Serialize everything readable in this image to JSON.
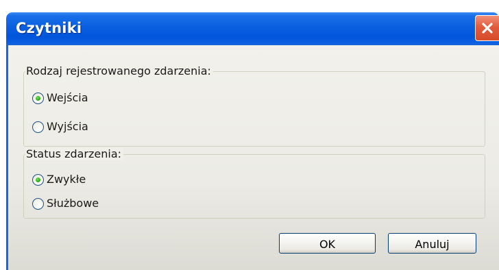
{
  "window": {
    "title": "Czytniki",
    "close_icon": "close-icon",
    "title_color": "#0055da",
    "close_color": "#e15c3c"
  },
  "event_type_group": {
    "label": "Rodzaj rejestrowanego zdarzenia:",
    "options": [
      {
        "label": "Wejścia",
        "selected": true
      },
      {
        "label": "Wyjścia",
        "selected": false
      }
    ]
  },
  "event_status_group": {
    "label": "Status zdarzenia:",
    "options": [
      {
        "label": "Zwykłe",
        "selected": true
      },
      {
        "label": "Służbowe",
        "selected": false
      }
    ]
  },
  "buttons": {
    "ok_label": "OK",
    "cancel_label": "Anuluj"
  },
  "colors": {
    "radio_selected": "#31b11b",
    "dialog_bg": "#ecebe5"
  }
}
